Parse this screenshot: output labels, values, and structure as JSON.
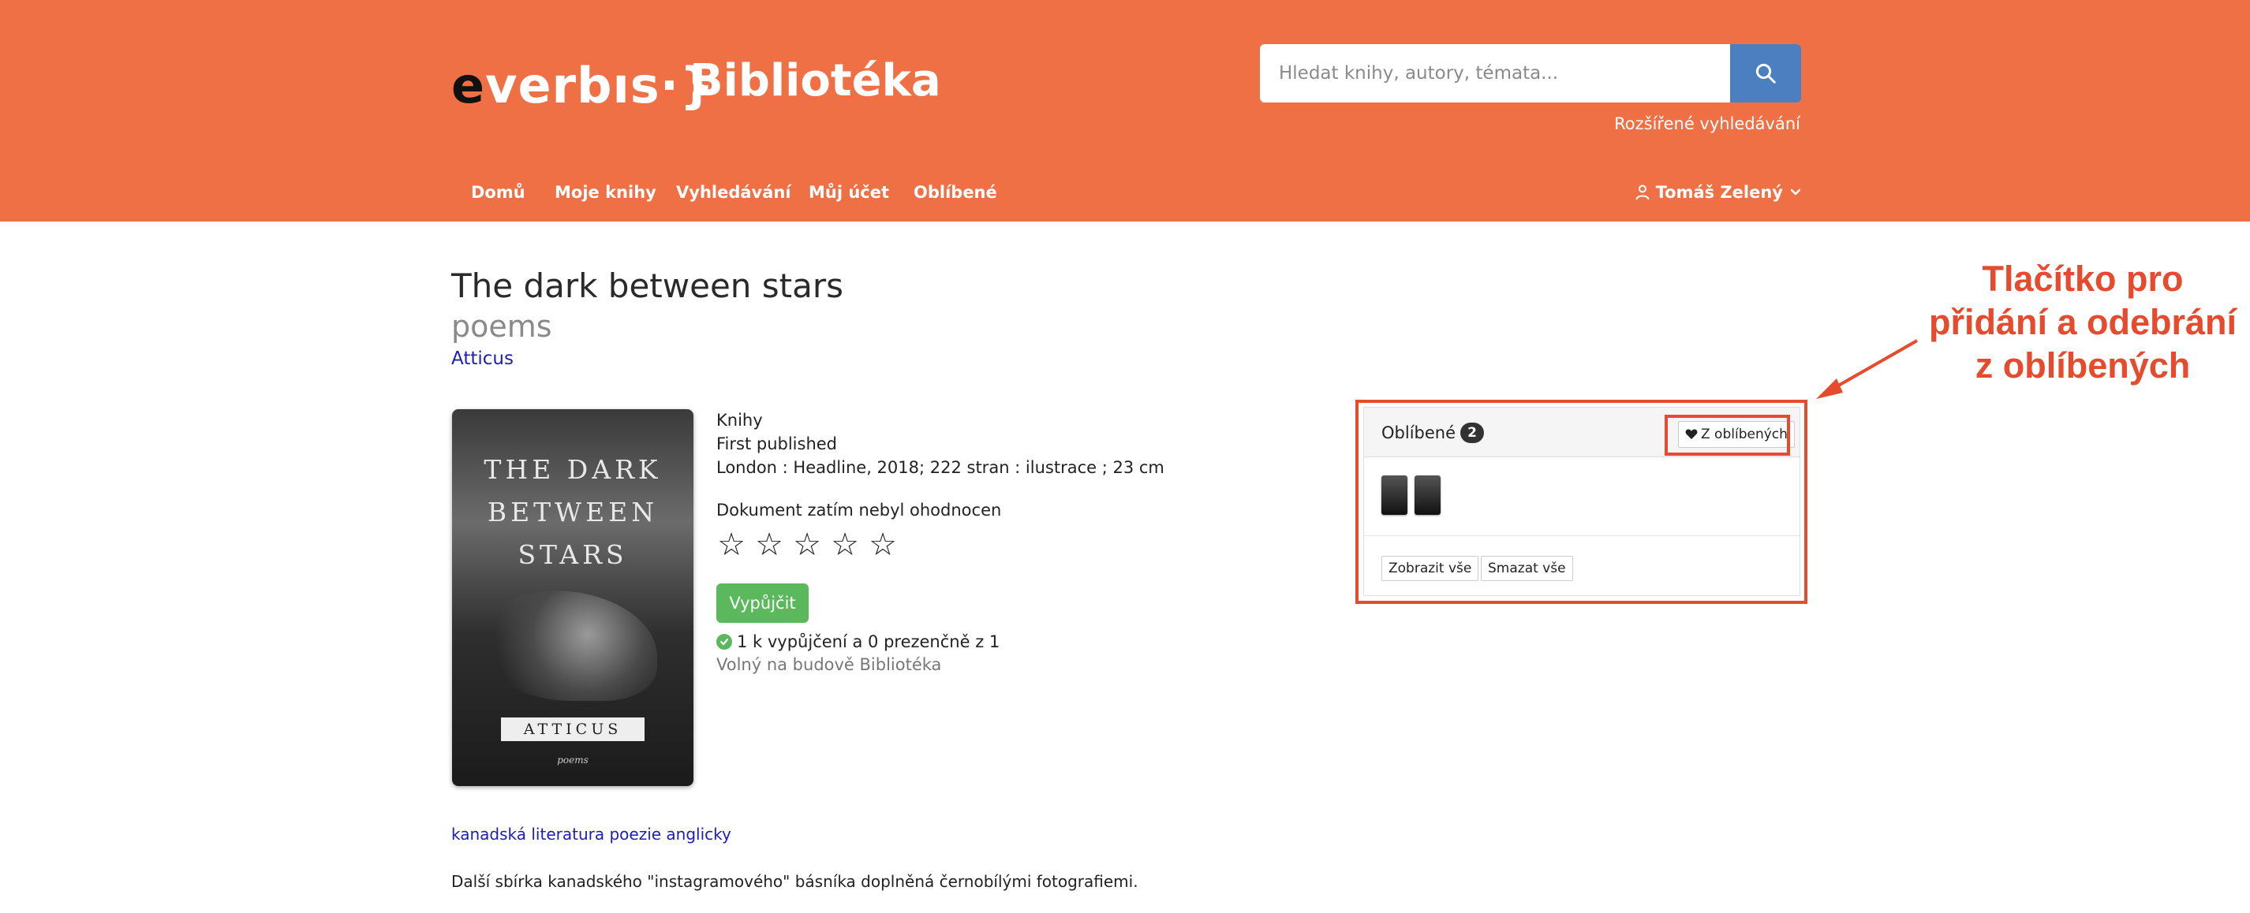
{
  "brand": {
    "logo_e": "e",
    "logo_rest": "verbıs·}",
    "site_title": "Bibliotéka",
    "accent_color": "#ee7044"
  },
  "search": {
    "placeholder": "Hledat knihy, autory, témata...",
    "icon": "search-icon",
    "advanced_label": "Rozšířené vyhledávání"
  },
  "nav": {
    "items": [
      "Domů",
      "Moje knihy",
      "Vyhledávání",
      "Můj účet",
      "Oblíbené"
    ],
    "user_name": "Tomáš Zelený",
    "user_icon": "user-icon",
    "chevron_icon": "chevron-down-icon"
  },
  "book": {
    "title": "The dark between stars",
    "subtitle": "poems",
    "author": "Atticus",
    "cover_title": "THE DARK BETWEEN STARS",
    "cover_author": "ATTICUS",
    "cover_sub": "poems",
    "type": "Knihy",
    "edition": "First published",
    "publication": "London : Headline, 2018; 222 stran : ilustrace ; 23 cm",
    "rating_text": "Dokument zatím nebyl ohodnocen",
    "rating_stars": 0,
    "rating_max": 5,
    "borrow_label": "Vypůjčit",
    "availability": "1 k vypůjčení a 0 prezenčně z 1",
    "location": "Volný na budově Bibliotéka",
    "subjects": "kanadská literatura poezie anglicky",
    "description": "Další sbírka kanadského \"instagramového\" básníka doplněná černobílými fotografiemi."
  },
  "favorites": {
    "title": "Oblíbené",
    "count": "2",
    "toggle_label": "Z oblíbených",
    "toggle_icon": "heart-icon",
    "show_all": "Zobrazit vše",
    "delete_all": "Smazat vše"
  },
  "annotation": {
    "lines": [
      "Tlačítko pro",
      "přidání a odebrání",
      "z oblíbených"
    ],
    "color": "#e54b2c"
  }
}
